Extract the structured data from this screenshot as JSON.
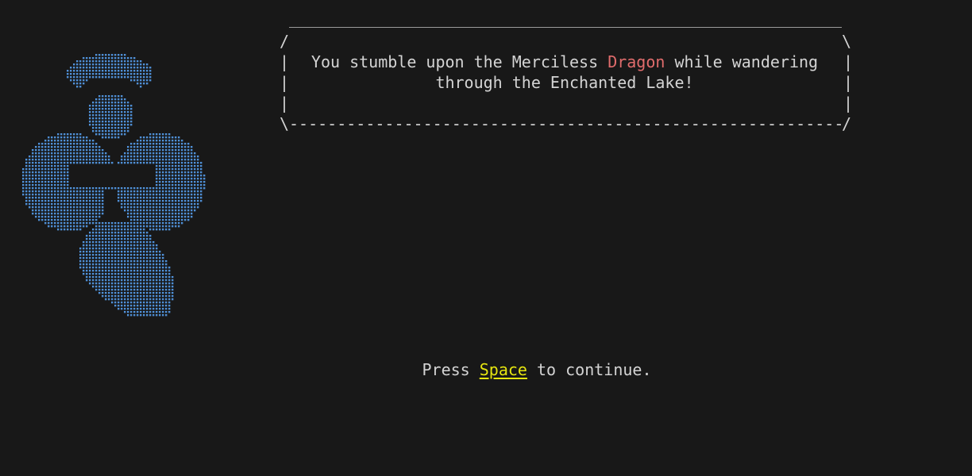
{
  "dialog": {
    "line1_before": "You stumble upon the Merciless ",
    "enemy_name": "Dragon",
    "line1_after": " while wandering",
    "line2": "through the Enchanted Lake!",
    "enemy_color": "#e06c6c"
  },
  "prompt": {
    "before": "Press ",
    "key": "Space",
    "after": " to continue.",
    "key_color": "#e5e510"
  },
  "sprite": {
    "name": "dragon-ascii-art",
    "color": "#4f8fd6"
  }
}
